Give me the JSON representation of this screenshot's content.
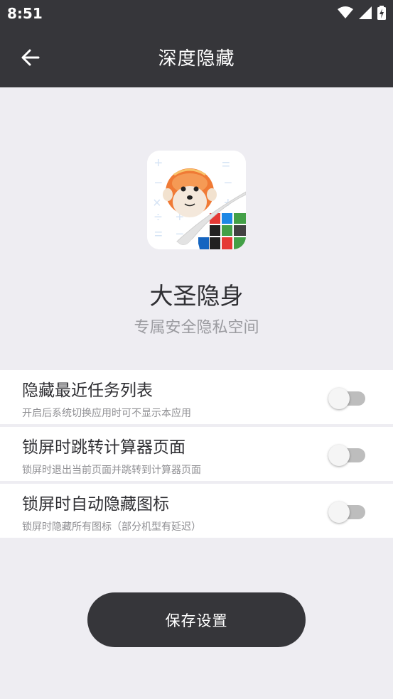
{
  "status_bar": {
    "time": "8:51",
    "icons": [
      "wifi-icon",
      "signal-icon",
      "battery-charging-icon"
    ]
  },
  "app_bar": {
    "title": "深度隐藏",
    "back_icon": "arrow-left-icon"
  },
  "hero": {
    "logo_icon": "monkey-calculator-logo",
    "app_name": "大圣隐身",
    "slogan": "专属安全隐私空间"
  },
  "settings": [
    {
      "title": "隐藏最近任务列表",
      "description": "开启后系统切换应用时可不显示本应用",
      "enabled": false
    },
    {
      "title": "锁屏时跳转计算器页面",
      "description": "锁屏时退出当前页面并跳转到计算器页面",
      "enabled": false
    },
    {
      "title": "锁屏时自动隐藏图标",
      "description": "锁屏时隐藏所有图标（部分机型有延迟）",
      "enabled": false
    }
  ],
  "save_button": {
    "label": "保存设置"
  },
  "colors": {
    "bar": "#36363a",
    "background": "#eeedf2",
    "switch_off_track": "#bdbdbd"
  }
}
